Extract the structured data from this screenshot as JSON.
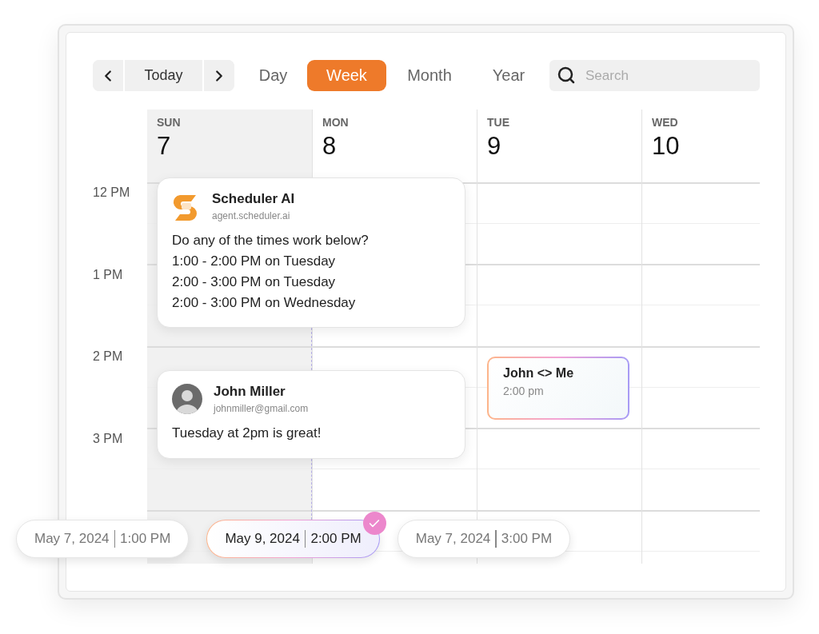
{
  "nav": {
    "today": "Today"
  },
  "views": [
    {
      "label": "Day",
      "selected": false
    },
    {
      "label": "Week",
      "selected": true
    },
    {
      "label": "Month",
      "selected": false
    },
    {
      "label": "Year",
      "selected": false
    }
  ],
  "search": {
    "placeholder": "Search"
  },
  "days": [
    {
      "weekday": "SUN",
      "date": "7",
      "highlighted": true
    },
    {
      "weekday": "MON",
      "date": "8",
      "highlighted": false
    },
    {
      "weekday": "TUE",
      "date": "9",
      "highlighted": false
    },
    {
      "weekday": "WED",
      "date": "10",
      "highlighted": false
    }
  ],
  "hours": [
    "12 PM",
    "1 PM",
    "2 PM",
    "3 PM"
  ],
  "messages": [
    {
      "kind": "agent",
      "name": "Scheduler AI",
      "handle": "agent.scheduler.ai",
      "lines": [
        "Do any of the times work below?",
        "1:00 - 2:00 PM on Tuesday",
        "2:00 - 3:00 PM on Tuesday",
        "2:00 - 3:00 PM on Wednesday"
      ]
    },
    {
      "kind": "person",
      "name": "John Miller",
      "handle": "johnmiller@gmail.com",
      "lines": [
        "Tuesday at 2pm is great!"
      ]
    }
  ],
  "event": {
    "title": "John <> Me",
    "time": "2:00 pm"
  },
  "slots": [
    {
      "date": "May 7, 2024",
      "time": "1:00 PM",
      "selected": false
    },
    {
      "date": "May 9, 2024",
      "time": "2:00 PM",
      "selected": true
    },
    {
      "date": "May 7, 2024",
      "time": "3:00 PM",
      "selected": false
    }
  ]
}
